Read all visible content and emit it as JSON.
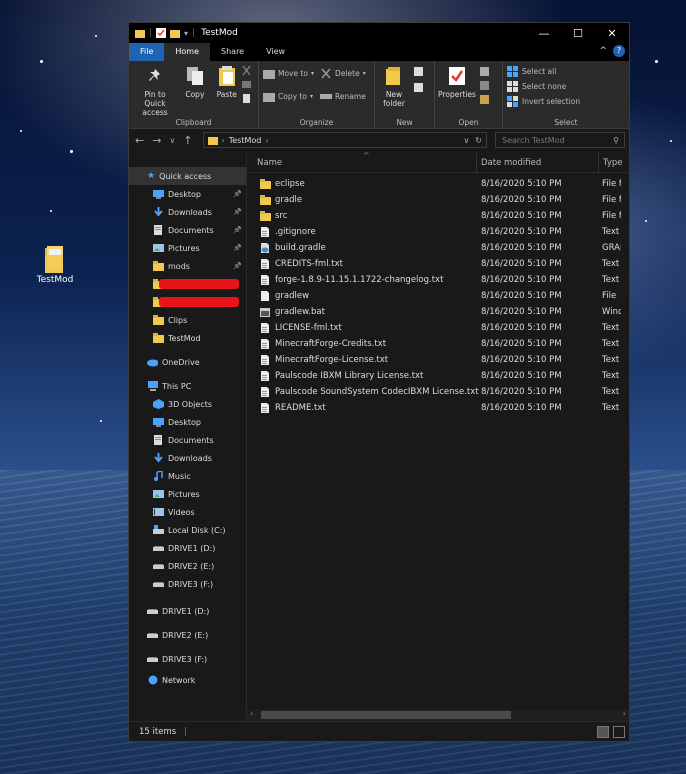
{
  "desktop": {
    "icon_label": "TestMod"
  },
  "window": {
    "title": "TestMod",
    "controls": {
      "minimize": "—",
      "maximize": "☐",
      "close": "✕"
    }
  },
  "ribbon_tabs": [
    "File",
    "Home",
    "Share",
    "View"
  ],
  "ribbon": {
    "clipboard": {
      "pin_label": "Pin to Quick access",
      "copy_label": "Copy",
      "paste_label": "Paste",
      "group_label": "Clipboard"
    },
    "organize": {
      "move_to": "Move to",
      "copy_to": "Copy to",
      "delete": "Delete",
      "rename": "Rename",
      "group_label": "Organize"
    },
    "new": {
      "new_folder": "New folder",
      "group_label": "New"
    },
    "open": {
      "properties": "Properties",
      "group_label": "Open"
    },
    "select": {
      "select_all": "Select all",
      "select_none": "Select none",
      "invert_selection": "Invert selection",
      "group_label": "Select"
    }
  },
  "address": {
    "path": "TestMod",
    "search_placeholder": "Search TestMod"
  },
  "nav": {
    "quick_access": "Quick access",
    "quick_items": [
      {
        "label": "Desktop",
        "icon": "desktop-icon",
        "pinned": true
      },
      {
        "label": "Downloads",
        "icon": "download-icon",
        "pinned": true
      },
      {
        "label": "Documents",
        "icon": "documents-icon",
        "pinned": true
      },
      {
        "label": "Pictures",
        "icon": "pictures-icon",
        "pinned": true
      },
      {
        "label": "mods",
        "icon": "folder-icon",
        "pinned": true
      },
      {
        "label": "",
        "icon": "folder-icon",
        "pinned": false
      },
      {
        "label": "",
        "icon": "folder-icon",
        "pinned": false
      },
      {
        "label": "Clips",
        "icon": "folder-icon",
        "pinned": false
      },
      {
        "label": "TestMod",
        "icon": "folder-icon",
        "pinned": false
      }
    ],
    "onedrive": "OneDrive",
    "this_pc": "This PC",
    "pc_items": [
      "3D Objects",
      "Desktop",
      "Documents",
      "Downloads",
      "Music",
      "Pictures",
      "Videos",
      "Local Disk (C:)",
      "DRIVE1 (D:)",
      "DRIVE2 (E:)",
      "DRIVE3 (F:)"
    ],
    "drives": [
      "DRIVE1 (D:)",
      "DRIVE2 (E:)",
      "DRIVE3 (F:)"
    ],
    "network": "Network"
  },
  "columns": {
    "name": "Name",
    "date": "Date modified",
    "type": "Type"
  },
  "files": [
    {
      "name": "eclipse",
      "date": "8/16/2020 5:10 PM",
      "type": "File fo",
      "kind": "folder"
    },
    {
      "name": "gradle",
      "date": "8/16/2020 5:10 PM",
      "type": "File fo",
      "kind": "folder"
    },
    {
      "name": "src",
      "date": "8/16/2020 5:10 PM",
      "type": "File fo",
      "kind": "folder"
    },
    {
      "name": ".gitignore",
      "date": "8/16/2020 5:10 PM",
      "type": "Text D",
      "kind": "text"
    },
    {
      "name": "build.gradle",
      "date": "8/16/2020 5:10 PM",
      "type": "GRAD",
      "kind": "gradle"
    },
    {
      "name": "CREDITS-fml.txt",
      "date": "8/16/2020 5:10 PM",
      "type": "Text D",
      "kind": "text"
    },
    {
      "name": "forge-1.8.9-11.15.1.1722-changelog.txt",
      "date": "8/16/2020 5:10 PM",
      "type": "Text D",
      "kind": "text"
    },
    {
      "name": "gradlew",
      "date": "8/16/2020 5:10 PM",
      "type": "File",
      "kind": "blank"
    },
    {
      "name": "gradlew.bat",
      "date": "8/16/2020 5:10 PM",
      "type": "Wind",
      "kind": "bat"
    },
    {
      "name": "LICENSE-fml.txt",
      "date": "8/16/2020 5:10 PM",
      "type": "Text D",
      "kind": "text"
    },
    {
      "name": "MinecraftForge-Credits.txt",
      "date": "8/16/2020 5:10 PM",
      "type": "Text D",
      "kind": "text"
    },
    {
      "name": "MinecraftForge-License.txt",
      "date": "8/16/2020 5:10 PM",
      "type": "Text D",
      "kind": "text"
    },
    {
      "name": "Paulscode IBXM Library License.txt",
      "date": "8/16/2020 5:10 PM",
      "type": "Text D",
      "kind": "text"
    },
    {
      "name": "Paulscode SoundSystem CodecIBXM License.txt",
      "date": "8/16/2020 5:10 PM",
      "type": "Text D",
      "kind": "text"
    },
    {
      "name": "README.txt",
      "date": "8/16/2020 5:10 PM",
      "type": "Text D",
      "kind": "text"
    }
  ],
  "status": {
    "item_count": "15 items"
  },
  "colors": {
    "accent": "#1e64b4",
    "folder": "#f2c94c",
    "background": "#191919",
    "redaction": "#e8141a"
  }
}
